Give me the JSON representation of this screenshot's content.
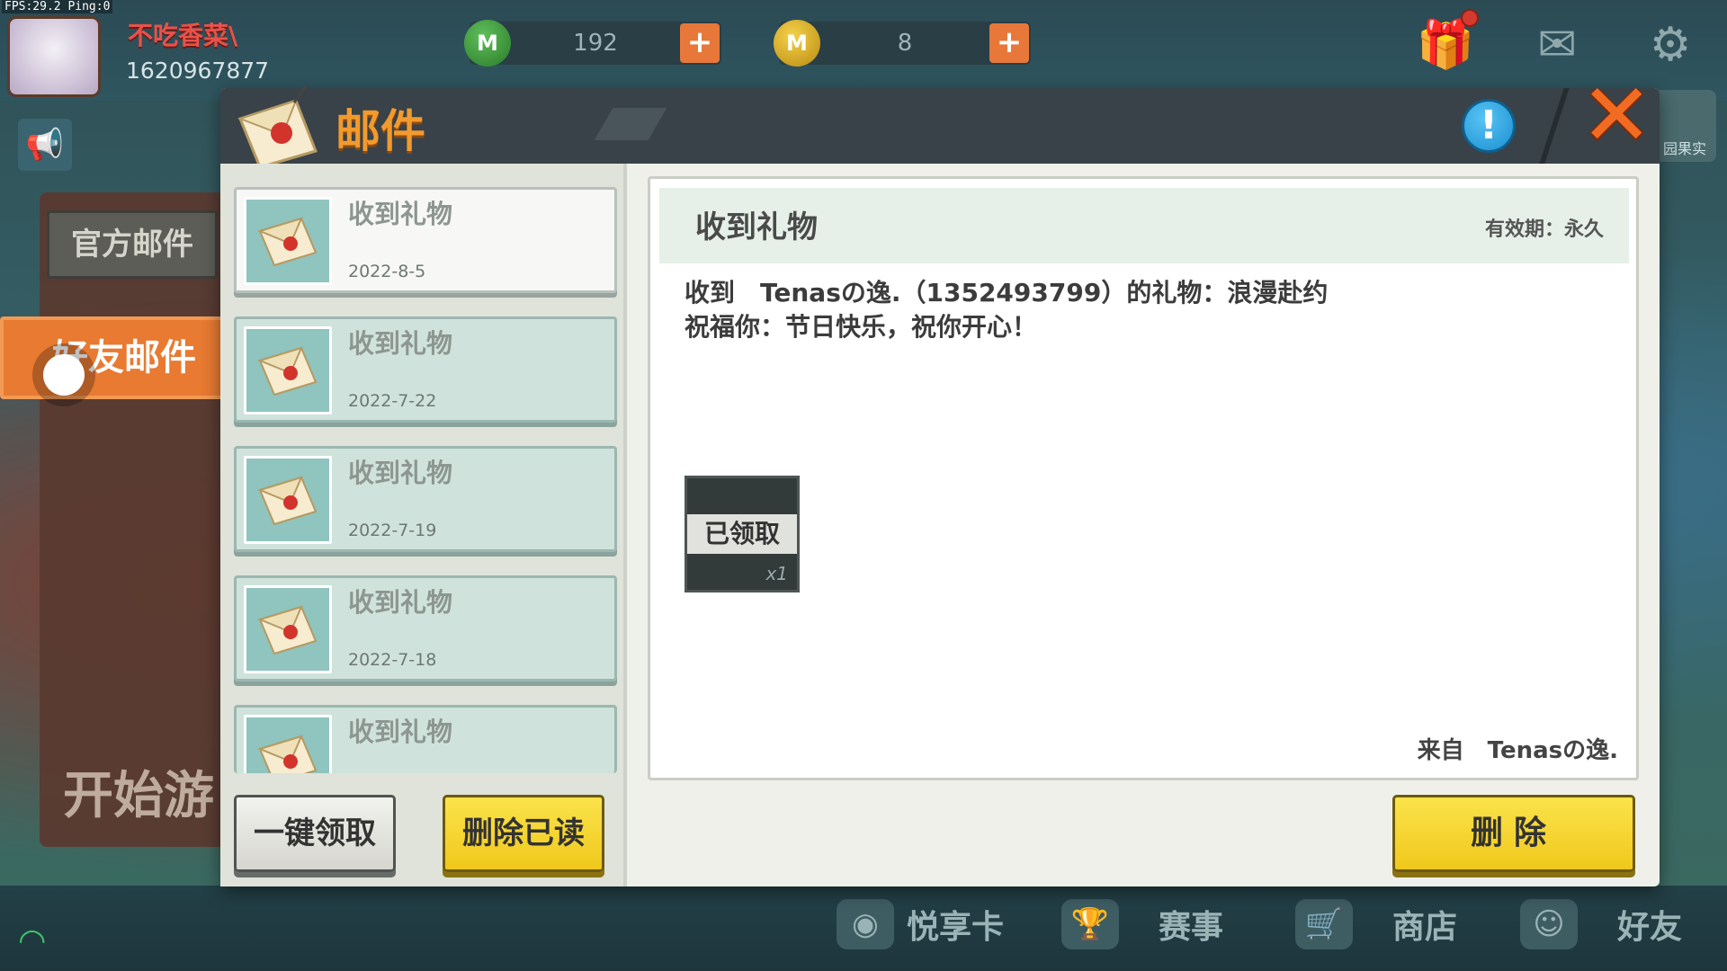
{
  "hud": {
    "fps_text": "FPS:29.2  Ping:0",
    "player_name": "不吃香菜\\",
    "player_id": "1620967877",
    "currency_green": "192",
    "currency_gold": "8",
    "right_badge": "园果实"
  },
  "sidebar": {
    "official_tab": "官方邮件",
    "friend_tab": "好友邮件",
    "start_game": "开始游"
  },
  "dialog": {
    "title": "邮件",
    "info_label": "!",
    "close_label": "✕"
  },
  "mail_list": [
    {
      "title": "收到礼物",
      "date": "2022-8-5",
      "selected": true
    },
    {
      "title": "收到礼物",
      "date": "2022-7-22",
      "selected": false
    },
    {
      "title": "收到礼物",
      "date": "2022-7-19",
      "selected": false
    },
    {
      "title": "收到礼物",
      "date": "2022-7-18",
      "selected": false
    },
    {
      "title": "收到礼物",
      "date": "",
      "selected": false
    }
  ],
  "list_actions": {
    "claim_all": "一键领取",
    "delete_read": "删除已读"
  },
  "detail": {
    "title": "收到礼物",
    "validity": "有效期：永久",
    "body_line1": "收到　Tenasの逸.（1352493799）的礼物：浪漫赴约",
    "body_line2": "祝福你：节日快乐，祝你开心！",
    "gift_status": "已领取",
    "gift_qty": "x1",
    "from": "来自　Tenasの逸.",
    "delete_label": "删除"
  },
  "bottom_nav": [
    {
      "label": "悦享卡",
      "icon": "card-icon"
    },
    {
      "label": "赛事",
      "icon": "trophy-icon"
    },
    {
      "label": "商店",
      "icon": "cart-icon"
    },
    {
      "label": "好友",
      "icon": "friends-icon"
    }
  ],
  "colors": {
    "accent_orange": "#e87a32",
    "button_yellow": "#f0c81c",
    "title_orange": "#f29a2e"
  }
}
